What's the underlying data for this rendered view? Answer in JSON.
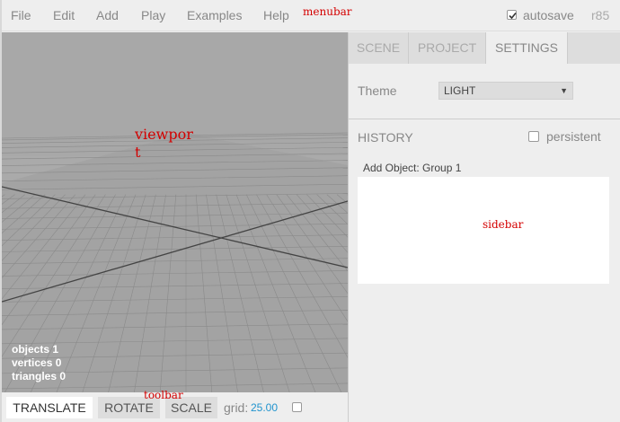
{
  "menubar": {
    "items": [
      "File",
      "Edit",
      "Add",
      "Play",
      "Examples",
      "Help"
    ],
    "annotation": "menubar",
    "autosave_label": "autosave",
    "autosave_checked": true,
    "version": "r85"
  },
  "viewport": {
    "annotation": "viewport",
    "info": {
      "objects_label": "objects",
      "objects_value": "1",
      "vertices_label": "vertices",
      "vertices_value": "0",
      "triangles_label": "triangles",
      "triangles_value": "0"
    }
  },
  "toolbar": {
    "annotation": "toolbar",
    "translate_label": "TRANSLATE",
    "rotate_label": "ROTATE",
    "scale_label": "SCALE",
    "active_tool": "TRANSLATE",
    "grid_label": "grid:",
    "grid_value": "25.00",
    "snap_checked": false
  },
  "sidebar": {
    "annotation": "sidebar",
    "tabs": [
      "SCENE",
      "PROJECT",
      "SETTINGS"
    ],
    "selected_tab": "SETTINGS",
    "theme_label": "Theme",
    "theme_value": "LIGHT",
    "history_label": "HISTORY",
    "persistent_label": "persistent",
    "persistent_checked": false,
    "history_items": [
      "Add Object: Group 1"
    ]
  },
  "colors": {
    "accent": "#2194ce",
    "annotation": "#d40000",
    "viewport_bg": "#aaaaaa"
  }
}
